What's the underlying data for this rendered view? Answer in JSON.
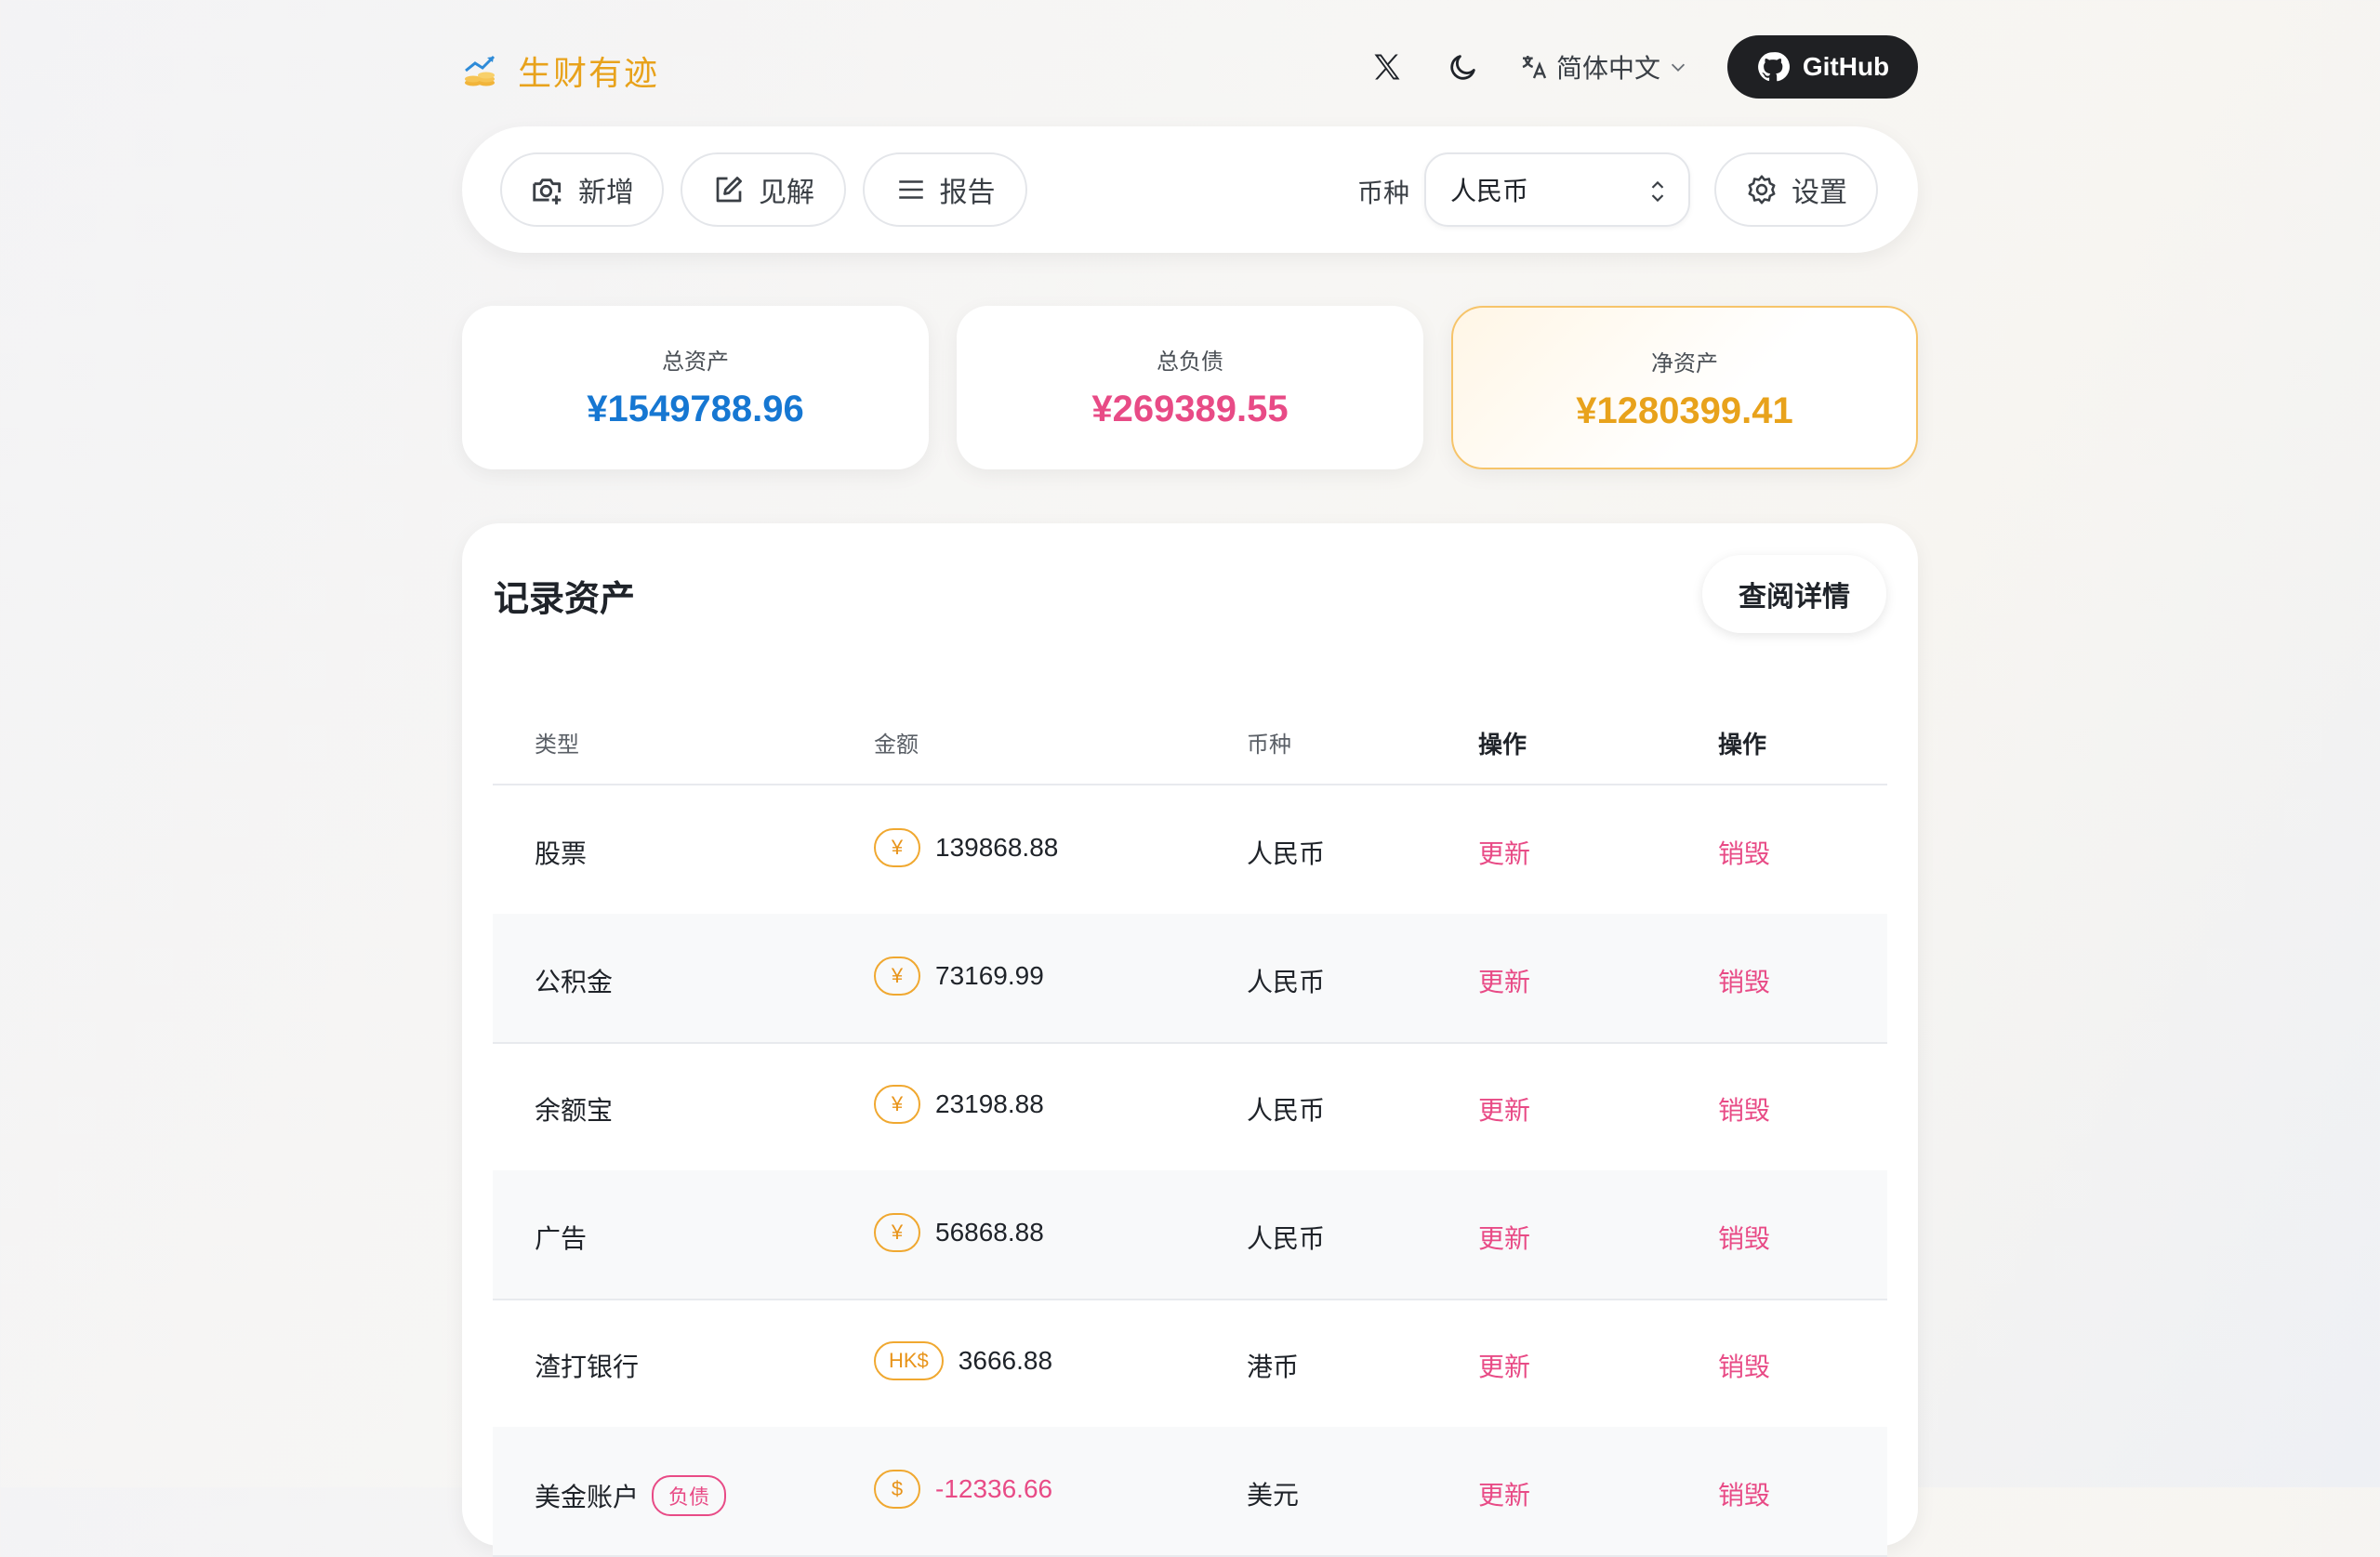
{
  "app": {
    "title": "生财有迹"
  },
  "header": {
    "x_icon": "x-logo-icon",
    "theme_icon": "moon-icon",
    "language": "简体中文",
    "github_label": "GitHub"
  },
  "toolbar": {
    "add_label": "新增",
    "insight_label": "见解",
    "report_label": "报告",
    "currency_label": "币种",
    "currency_value": "人民币",
    "settings_label": "设置"
  },
  "summary": {
    "total_assets_label": "总资产",
    "total_assets_value": "¥1549788.96",
    "total_liabilities_label": "总负债",
    "total_liabilities_value": "¥269389.55",
    "net_assets_label": "净资产",
    "net_assets_value": "¥1280399.41",
    "colors": {
      "assets": "#1677d2",
      "liabilities": "#e84b86",
      "net": "#e8a21b"
    }
  },
  "assets_panel": {
    "title": "记录资产",
    "detail_button": "查阅详情",
    "columns": [
      "类型",
      "金额",
      "币种",
      "操作",
      "操作"
    ],
    "rows": [
      {
        "type": "股票",
        "symbol": "¥",
        "amount": "139868.88",
        "currency": "人民币",
        "update": "更新",
        "delete": "销毁"
      },
      {
        "type": "公积金",
        "symbol": "¥",
        "amount": "73169.99",
        "currency": "人民币",
        "update": "更新",
        "delete": "销毁"
      },
      {
        "type": "余额宝",
        "symbol": "¥",
        "amount": "23198.88",
        "currency": "人民币",
        "update": "更新",
        "delete": "销毁"
      },
      {
        "type": "广告",
        "symbol": "¥",
        "amount": "56868.88",
        "currency": "人民币",
        "update": "更新",
        "delete": "销毁"
      },
      {
        "type": "渣打银行",
        "symbol": "HK$",
        "amount": "3666.88",
        "currency": "港币",
        "update": "更新",
        "delete": "销毁"
      },
      {
        "type": "美金账户",
        "tag": "负债",
        "symbol": "$",
        "amount": "-12336.66",
        "currency": "美元",
        "update": "更新",
        "delete": "销毁"
      }
    ]
  }
}
